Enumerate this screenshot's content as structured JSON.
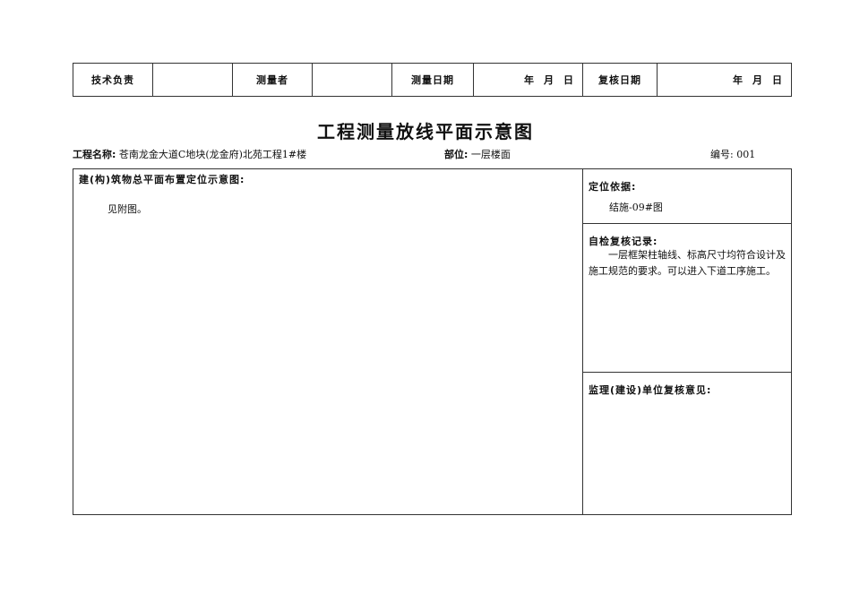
{
  "header_table": {
    "tech_lead": "技术负责",
    "measurer": "测量者",
    "measure_date": "测量日期",
    "date_placeholder": "年　月　日",
    "review_date": "复核日期",
    "review_date_placeholder": "年　月　日"
  },
  "title": "工程测量放线平面示意图",
  "info": {
    "project_label": "工程名称:",
    "project_value": "苍南龙金大道C地块(龙金府)北苑工程1#楼",
    "location_label": "部位:",
    "location_value": "一层楼面",
    "number_label": "编号:",
    "number_value": "001"
  },
  "main": {
    "layout_label": "建(构)筑物总平面布置定位示意图:",
    "layout_value": "见附图。"
  },
  "right": {
    "basis_label": "定位依据:",
    "basis_value": "结施-09#图",
    "self_check_label": "自检复核记录:",
    "self_check_value": "　　一层框架柱轴线、标高尺寸均符合设计及施工规范的要求。可以进入下道工序施工。",
    "supervision_label": "监理(建设)单位复核意见:"
  }
}
